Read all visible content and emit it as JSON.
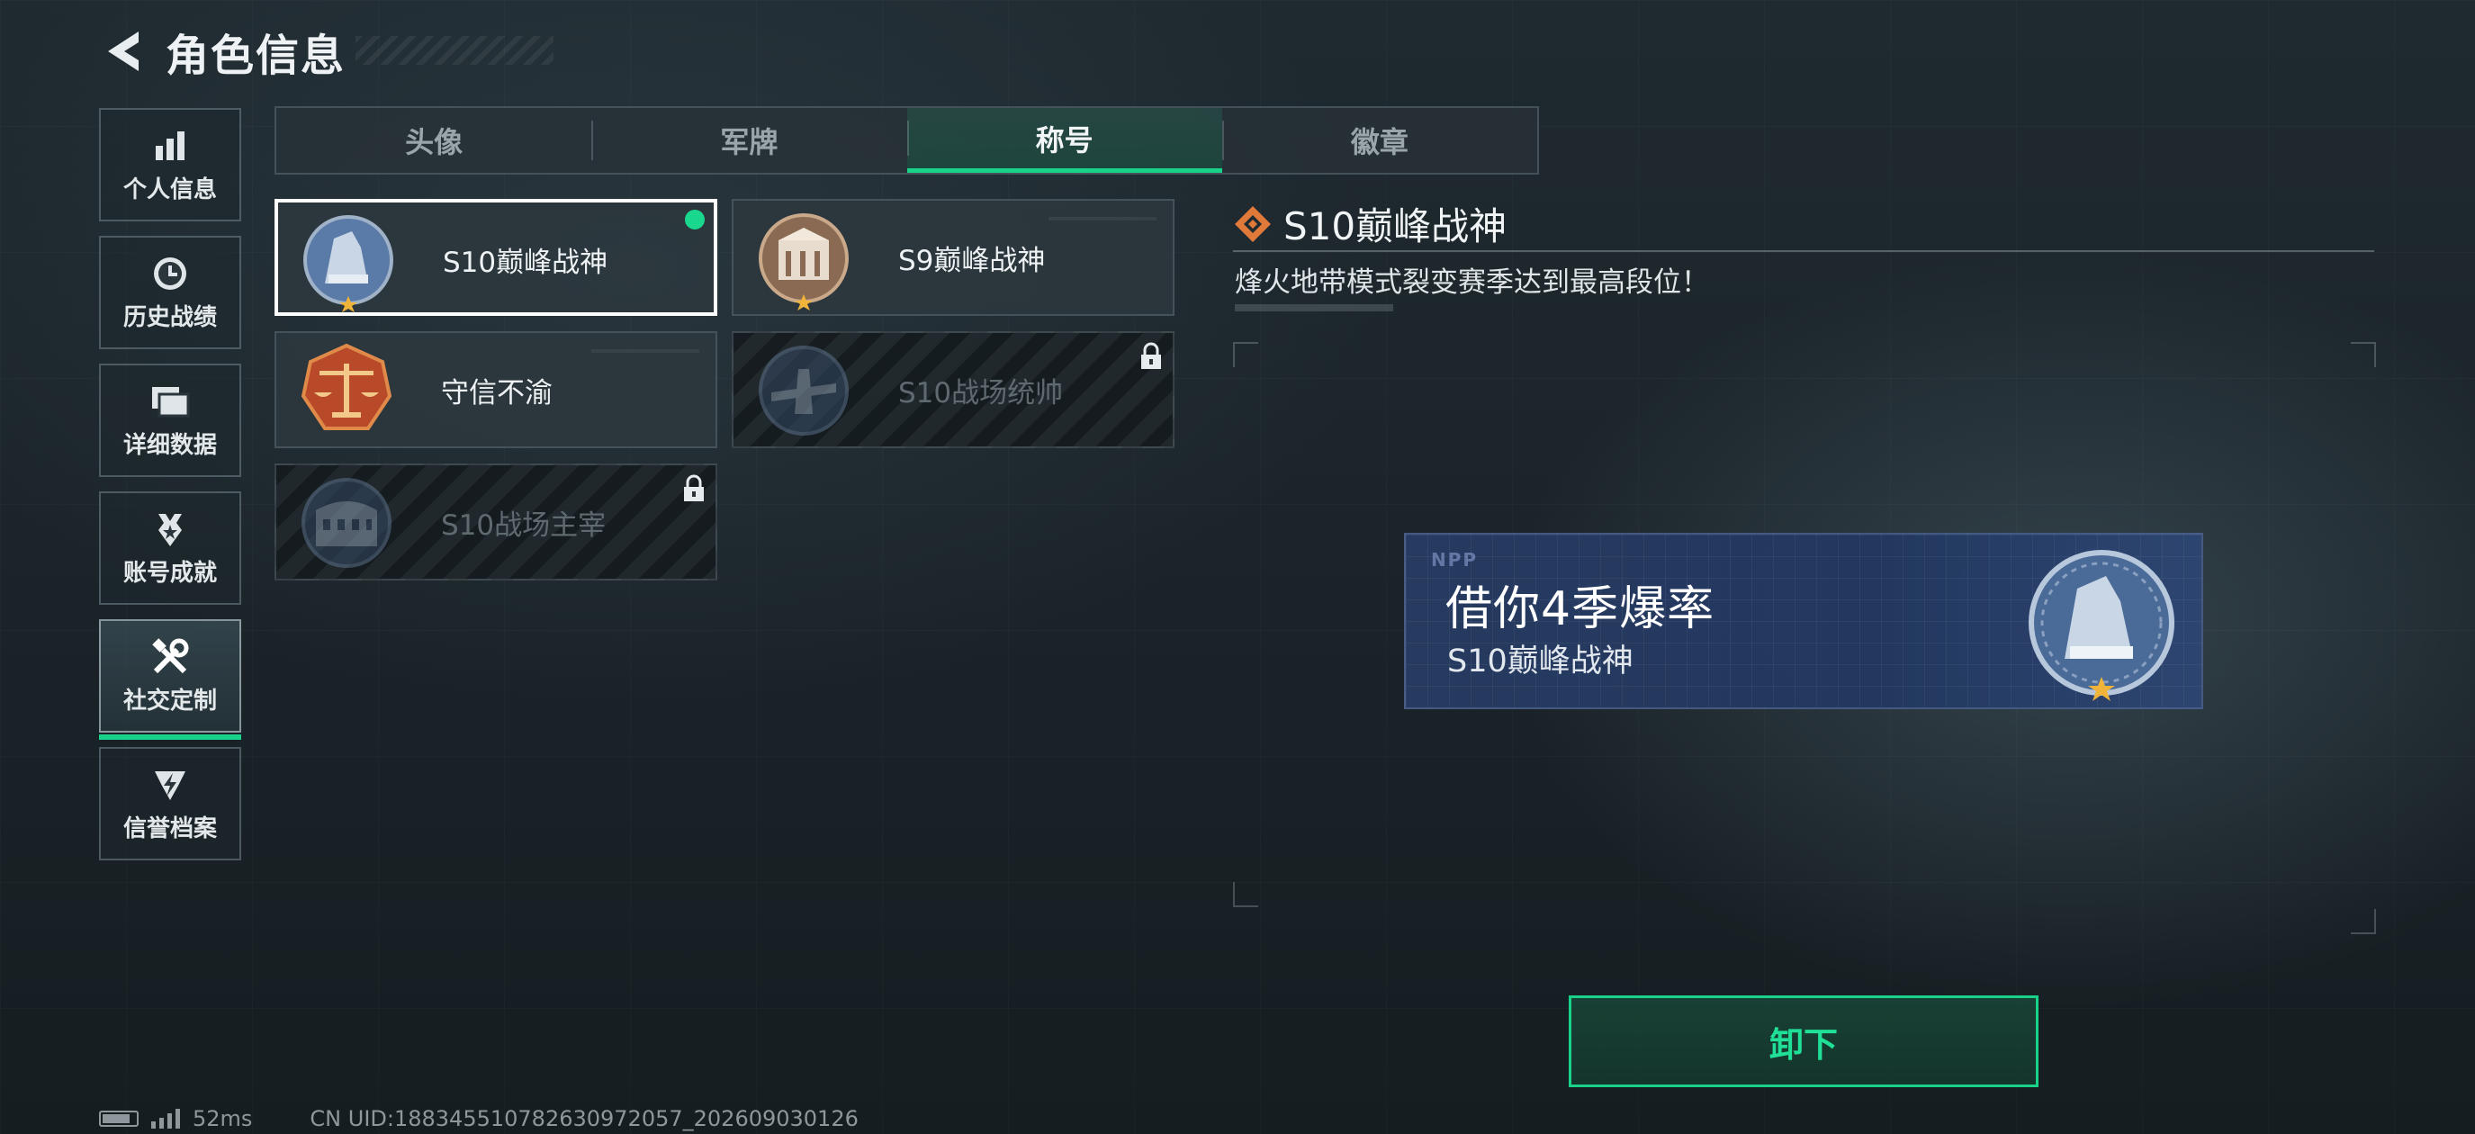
{
  "header": {
    "title": "角色信息"
  },
  "sidebar": {
    "items": [
      {
        "label": "个人信息",
        "icon": "bar-chart-icon"
      },
      {
        "label": "历史战绩",
        "icon": "clock-icon"
      },
      {
        "label": "详细数据",
        "icon": "folder-icon"
      },
      {
        "label": "账号成就",
        "icon": "achievement-icon"
      },
      {
        "label": "社交定制",
        "icon": "tools-icon",
        "active": true
      },
      {
        "label": "信誉档案",
        "icon": "shield-bolt-icon"
      }
    ]
  },
  "tabs": [
    {
      "label": "头像"
    },
    {
      "label": "军牌"
    },
    {
      "label": "称号",
      "active": true
    },
    {
      "label": "徽章"
    }
  ],
  "titles": [
    {
      "name": "S10巅峰战神",
      "selected": true,
      "equipped": true,
      "locked": false,
      "icon": "s10-peak-emblem-icon"
    },
    {
      "name": "S9巅峰战神",
      "selected": false,
      "equipped": false,
      "locked": false,
      "icon": "s9-peak-emblem-icon"
    },
    {
      "name": "守信不渝",
      "selected": false,
      "equipped": false,
      "locked": false,
      "icon": "scales-emblem-icon"
    },
    {
      "name": "S10战场统帅",
      "selected": false,
      "equipped": false,
      "locked": true,
      "icon": "aircraft-emblem-icon"
    },
    {
      "name": "S10战场主宰",
      "selected": false,
      "equipped": false,
      "locked": true,
      "icon": "colosseum-emblem-icon"
    }
  ],
  "detail": {
    "title": "S10巅峰战神",
    "description": "烽火地带模式裂变赛季达到最高段位！"
  },
  "preview": {
    "logo": "NPP",
    "slogan": "借你4季爆率",
    "title": "S10巅峰战神"
  },
  "actions": {
    "unequip_label": "卸下"
  },
  "footer": {
    "ping": "52ms",
    "uid": "CN UID:18834551078263097205​7_202609030126"
  },
  "colors": {
    "accent": "#19d28a",
    "selected_border": "#ffffff",
    "detail_icon": "#e07a3a"
  }
}
